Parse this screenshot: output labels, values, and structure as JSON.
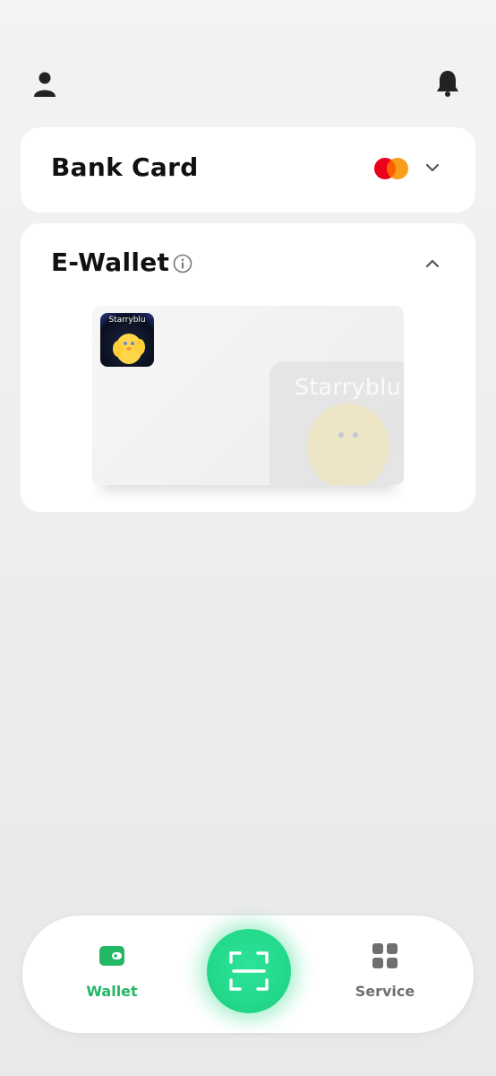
{
  "header": {
    "profile_icon": "person-icon",
    "notification_icon": "bell-icon"
  },
  "bank_card": {
    "title": "Bank Card",
    "brand_icon": "mastercard-icon",
    "toggle_icon": "chevron-down-icon",
    "expanded": false
  },
  "e_wallet": {
    "title": "E-Wallet",
    "info_icon": "info-icon",
    "toggle_icon": "chevron-up-icon",
    "expanded": true,
    "card": {
      "logo_text": "Starryblu",
      "watermark_text": "Starryblu"
    }
  },
  "bottom_nav": {
    "items": [
      {
        "label": "Wallet",
        "icon": "wallet-icon",
        "active": true
      },
      {
        "label": "Service",
        "icon": "grid-icon",
        "active": false
      }
    ],
    "scan_icon": "scan-icon"
  },
  "colors": {
    "accent": "#22b865",
    "scan_button": "#23d98a",
    "inactive_nav": "#6f6f6f",
    "mastercard_red": "#eb001b",
    "mastercard_orange": "#f79e1b"
  }
}
